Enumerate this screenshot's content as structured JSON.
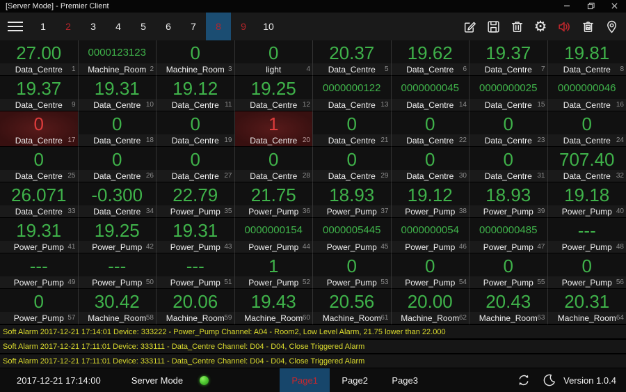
{
  "window": {
    "title": "[Server Mode] - Premier Client",
    "controls": [
      "minimize",
      "restore",
      "close"
    ]
  },
  "colors": {
    "value-green": "#3fb24a",
    "alarm-red": "#dd3c3c",
    "tab-alarm-red": "#b5262b",
    "selected-blue": "#1b4d72",
    "alarm-yellow": "#dcdc2e",
    "led-green": "#52cc33"
  },
  "toolbar": {
    "tabs": [
      {
        "label": "1",
        "alarm": false,
        "selected": false
      },
      {
        "label": "2",
        "alarm": true,
        "selected": false
      },
      {
        "label": "3",
        "alarm": false,
        "selected": false
      },
      {
        "label": "4",
        "alarm": false,
        "selected": false
      },
      {
        "label": "5",
        "alarm": false,
        "selected": false
      },
      {
        "label": "6",
        "alarm": false,
        "selected": false
      },
      {
        "label": "7",
        "alarm": false,
        "selected": false
      },
      {
        "label": "8",
        "alarm": true,
        "selected": true
      },
      {
        "label": "9",
        "alarm": true,
        "selected": false
      },
      {
        "label": "10",
        "alarm": false,
        "selected": false
      }
    ],
    "actions": [
      "edit-icon",
      "save-icon",
      "delete-icon",
      "settings-icon",
      "sound-icon",
      "image-delete-icon",
      "location-icon"
    ]
  },
  "tiles": [
    {
      "value": "27.00",
      "label": "Data_Centre",
      "index": "1",
      "alarm": false
    },
    {
      "value": "0000123123",
      "label": "Machine_Room",
      "index": "2",
      "alarm": false
    },
    {
      "value": "0",
      "label": "Machine_Room",
      "index": "3",
      "alarm": false
    },
    {
      "value": "0",
      "label": "light",
      "index": "4",
      "alarm": false
    },
    {
      "value": "20.37",
      "label": "Data_Centre",
      "index": "5",
      "alarm": false
    },
    {
      "value": "19.62",
      "label": "Data_Centre",
      "index": "6",
      "alarm": false
    },
    {
      "value": "19.37",
      "label": "Data_Centre",
      "index": "7",
      "alarm": false
    },
    {
      "value": "19.81",
      "label": "Data_Centre",
      "index": "8",
      "alarm": false
    },
    {
      "value": "19.37",
      "label": "Data_Centre",
      "index": "9",
      "alarm": false
    },
    {
      "value": "19.31",
      "label": "Data_Centre",
      "index": "10",
      "alarm": false
    },
    {
      "value": "19.12",
      "label": "Data_Centre",
      "index": "11",
      "alarm": false
    },
    {
      "value": "19.25",
      "label": "Data_Centre",
      "index": "12",
      "alarm": false
    },
    {
      "value": "0000000122",
      "label": "Data_Centre",
      "index": "13",
      "alarm": false
    },
    {
      "value": "0000000045",
      "label": "Data_Centre",
      "index": "14",
      "alarm": false
    },
    {
      "value": "0000000025",
      "label": "Data_Centre",
      "index": "15",
      "alarm": false
    },
    {
      "value": "0000000046",
      "label": "Data_Centre",
      "index": "16",
      "alarm": false
    },
    {
      "value": "0",
      "label": "Data_Centre",
      "index": "17",
      "alarm": true
    },
    {
      "value": "0",
      "label": "Data_Centre",
      "index": "18",
      "alarm": false
    },
    {
      "value": "0",
      "label": "Data_Centre",
      "index": "19",
      "alarm": false
    },
    {
      "value": "1",
      "label": "Data_Centre",
      "index": "20",
      "alarm": true
    },
    {
      "value": "0",
      "label": "Data_Centre",
      "index": "21",
      "alarm": false
    },
    {
      "value": "0",
      "label": "Data_Centre",
      "index": "22",
      "alarm": false
    },
    {
      "value": "0",
      "label": "Data_Centre",
      "index": "23",
      "alarm": false
    },
    {
      "value": "0",
      "label": "Data_Centre",
      "index": "24",
      "alarm": false
    },
    {
      "value": "0",
      "label": "Data_Centre",
      "index": "25",
      "alarm": false
    },
    {
      "value": "0",
      "label": "Data_Centre",
      "index": "26",
      "alarm": false
    },
    {
      "value": "0",
      "label": "Data_Centre",
      "index": "27",
      "alarm": false
    },
    {
      "value": "0",
      "label": "Data_Centre",
      "index": "28",
      "alarm": false
    },
    {
      "value": "0",
      "label": "Data_Centre",
      "index": "29",
      "alarm": false
    },
    {
      "value": "0",
      "label": "Data_Centre",
      "index": "30",
      "alarm": false
    },
    {
      "value": "0",
      "label": "Data_Centre",
      "index": "31",
      "alarm": false
    },
    {
      "value": "707.40",
      "label": "Data_Centre",
      "index": "32",
      "alarm": false
    },
    {
      "value": "26.071",
      "label": "Data_Centre",
      "index": "33",
      "alarm": false
    },
    {
      "value": "-0.300",
      "label": "Data_Centre",
      "index": "34",
      "alarm": false
    },
    {
      "value": "22.79",
      "label": "Power_Pump",
      "index": "35",
      "alarm": false
    },
    {
      "value": "21.75",
      "label": "Power_Pump",
      "index": "36",
      "alarm": false
    },
    {
      "value": "18.93",
      "label": "Power_Pump",
      "index": "37",
      "alarm": false
    },
    {
      "value": "19.12",
      "label": "Power_Pump",
      "index": "38",
      "alarm": false
    },
    {
      "value": "18.93",
      "label": "Power_Pump",
      "index": "39",
      "alarm": false
    },
    {
      "value": "19.18",
      "label": "Power_Pump",
      "index": "40",
      "alarm": false
    },
    {
      "value": "19.31",
      "label": "Power_Pump",
      "index": "41",
      "alarm": false
    },
    {
      "value": "19.25",
      "label": "Power_Pump",
      "index": "42",
      "alarm": false
    },
    {
      "value": "19.31",
      "label": "Power_Pump",
      "index": "43",
      "alarm": false
    },
    {
      "value": "0000000154",
      "label": "Power_Pump",
      "index": "44",
      "alarm": false
    },
    {
      "value": "0000005445",
      "label": "Power_Pump",
      "index": "45",
      "alarm": false
    },
    {
      "value": "0000000054",
      "label": "Power_Pump",
      "index": "46",
      "alarm": false
    },
    {
      "value": "0000000485",
      "label": "Power_Pump",
      "index": "47",
      "alarm": false
    },
    {
      "value": "---",
      "label": "Power_Pump",
      "index": "48",
      "alarm": false
    },
    {
      "value": "---",
      "label": "Power_Pump",
      "index": "49",
      "alarm": false
    },
    {
      "value": "---",
      "label": "Power_Pump",
      "index": "50",
      "alarm": false
    },
    {
      "value": "---",
      "label": "Power_Pump",
      "index": "51",
      "alarm": false
    },
    {
      "value": "1",
      "label": "Power_Pump",
      "index": "52",
      "alarm": false
    },
    {
      "value": "0",
      "label": "Power_Pump",
      "index": "53",
      "alarm": false
    },
    {
      "value": "0",
      "label": "Power_Pump",
      "index": "54",
      "alarm": false
    },
    {
      "value": "0",
      "label": "Power_Pump",
      "index": "55",
      "alarm": false
    },
    {
      "value": "0",
      "label": "Power_Pump",
      "index": "56",
      "alarm": false
    },
    {
      "value": "0",
      "label": "Power_Pump",
      "index": "57",
      "alarm": false
    },
    {
      "value": "30.42",
      "label": "Machine_Room",
      "index": "58",
      "alarm": false
    },
    {
      "value": "20.06",
      "label": "Machine_Room",
      "index": "59",
      "alarm": false
    },
    {
      "value": "19.43",
      "label": "Machine_Room",
      "index": "60",
      "alarm": false
    },
    {
      "value": "20.56",
      "label": "Machine_Room",
      "index": "61",
      "alarm": false
    },
    {
      "value": "20.00",
      "label": "Machine_Room",
      "index": "62",
      "alarm": false
    },
    {
      "value": "20.43",
      "label": "Machine_Room",
      "index": "63",
      "alarm": false
    },
    {
      "value": "20.31",
      "label": "Machine_Room",
      "index": "64",
      "alarm": false
    }
  ],
  "alarms": [
    "Soft Alarm 2017-12-21 17:14:01 Device: 333222 - Power_Pump Channel: A04 - Room2, Low Level Alarm, 21.75 lower than 22.000",
    "Soft Alarm 2017-12-21 17:11:01 Device: 333111 - Data_Centre Channel: D04 - D04, Close Triggered Alarm",
    "Soft Alarm 2017-12-21 17:11:01 Device: 333111 - Data_Centre Channel: D04 - D04, Close Triggered Alarm"
  ],
  "statusbar": {
    "datetime": "2017-12-21 17:14:00",
    "mode_label": "Server Mode",
    "pages": [
      {
        "label": "Page1",
        "selected": true
      },
      {
        "label": "Page2",
        "selected": false
      },
      {
        "label": "Page3",
        "selected": false
      }
    ],
    "icons": [
      "sync-icon",
      "night-mode-icon"
    ],
    "version": "Version 1.0.4"
  }
}
